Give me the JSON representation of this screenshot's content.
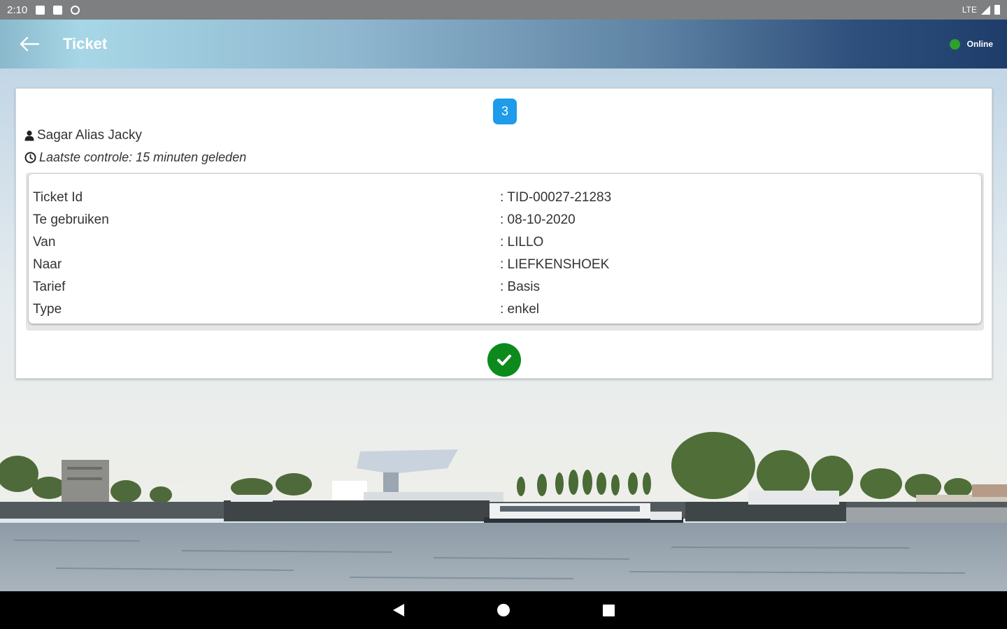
{
  "status_bar": {
    "time": "2:10",
    "network": "LTE"
  },
  "app_bar": {
    "title": "Ticket",
    "connection_status": "Online",
    "status_color": "#2ea02e"
  },
  "card": {
    "badge": "3",
    "user_name": "Sagar Alias Jacky",
    "last_check": "Laatste controle: 15 minuten geleden",
    "details": [
      {
        "label": "Ticket Id",
        "value": ": TID-00027-21283"
      },
      {
        "label": "Te gebruiken",
        "value": ": 08-10-2020"
      },
      {
        "label": "Van",
        "value": ": LILLO"
      },
      {
        "label": "Naar",
        "value": ": LIEFKENSHOEK"
      },
      {
        "label": "Tarief",
        "value": ": Basis"
      },
      {
        "label": "Type",
        "value": ": enkel"
      }
    ]
  },
  "icons": {
    "back": "arrow-left-icon",
    "user": "user-icon",
    "clock": "clock-icon",
    "valid": "checkmark-icon"
  }
}
